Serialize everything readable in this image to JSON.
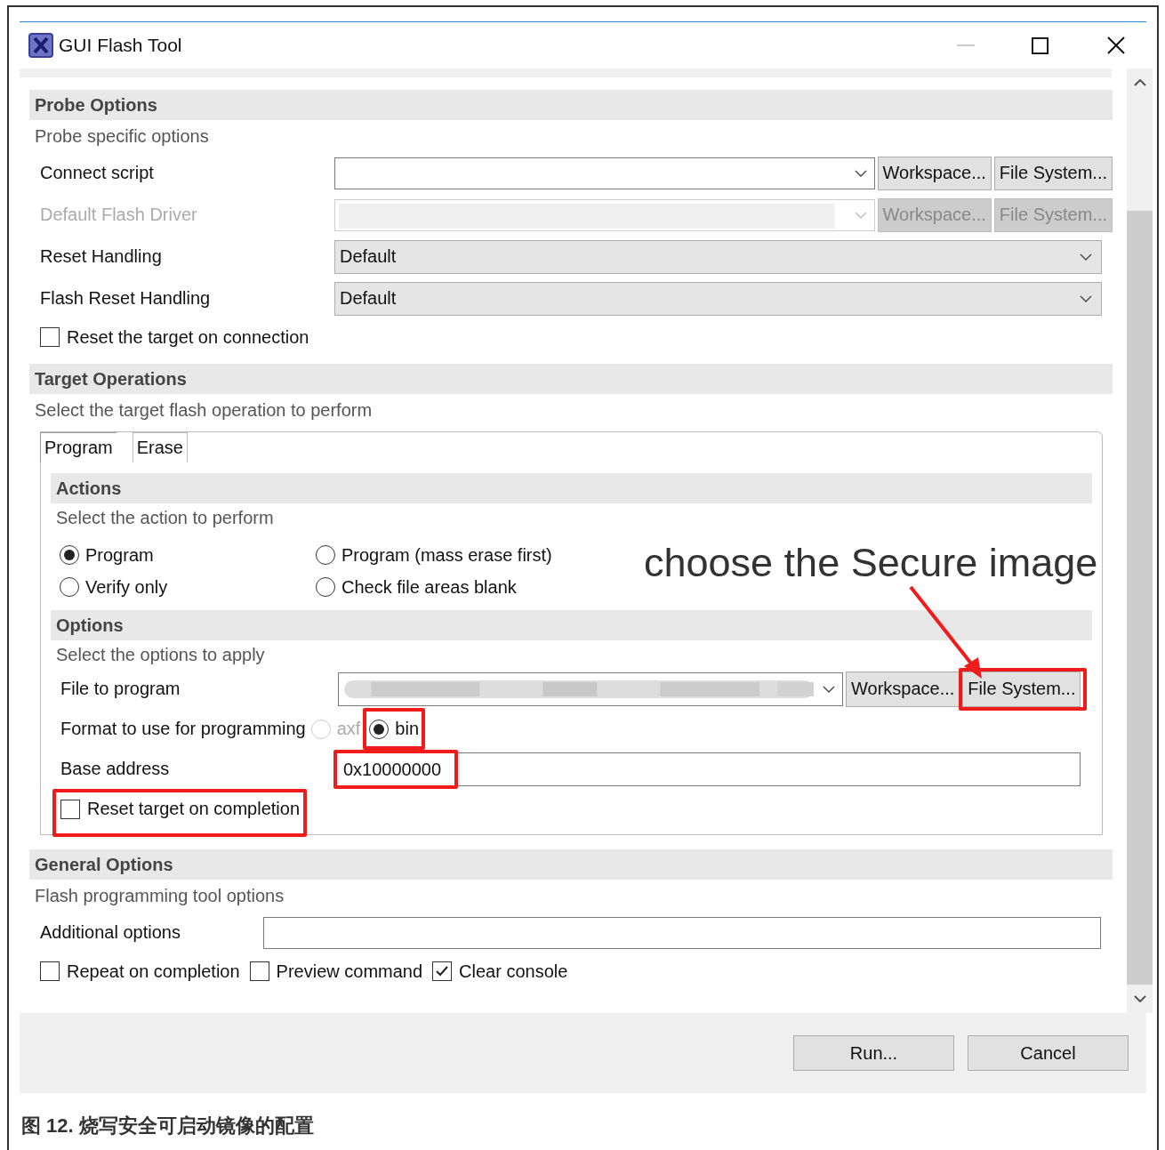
{
  "window": {
    "title": "GUI Flash Tool"
  },
  "probe_options": {
    "title": "Probe Options",
    "subtitle": "Probe specific options",
    "fields": [
      {
        "kind": "browse",
        "label": "Connect script",
        "disabled": false,
        "buttons": [
          "Workspace...",
          "File System..."
        ]
      },
      {
        "kind": "browse",
        "label": "Default Flash Driver",
        "disabled": true,
        "buttons": [
          "Workspace...",
          "File System..."
        ]
      },
      {
        "kind": "select",
        "label": "Reset Handling",
        "value": "Default"
      },
      {
        "kind": "select",
        "label": "Flash Reset Handling",
        "value": "Default"
      }
    ],
    "checkbox": {
      "label": "Reset the target on connection",
      "checked": false
    }
  },
  "target_operations": {
    "title": "Target Operations",
    "subtitle": "Select the target flash operation to perform",
    "tabs": [
      {
        "label": "Program",
        "selected": true
      },
      {
        "label": "Erase",
        "selected": false
      }
    ],
    "actions": {
      "title": "Actions",
      "subtitle": "Select the action to perform",
      "radios": [
        {
          "label": "Program",
          "selected": true
        },
        {
          "label": "Program (mass erase first)",
          "selected": false
        },
        {
          "label": "Verify only",
          "selected": false
        },
        {
          "label": "Check file areas blank",
          "selected": false
        }
      ]
    },
    "options": {
      "title": "Options",
      "subtitle": "Select the options to apply",
      "file_to_program": {
        "label": "File to program",
        "buttons": [
          {
            "label": "Workspace..."
          },
          {
            "label": "File System...",
            "highlighted": true
          }
        ]
      },
      "format": {
        "label": "Format to use for programming",
        "choices": [
          {
            "label": "axf",
            "selected": false,
            "disabled": true
          },
          {
            "label": "bin",
            "selected": true,
            "disabled": false,
            "highlighted": true
          }
        ]
      },
      "base_address": {
        "label": "Base address",
        "value": "0x10000000",
        "highlighted": true
      },
      "reset_checkbox": {
        "label": "Reset target on completion",
        "checked": false,
        "highlighted": true
      }
    }
  },
  "general_options": {
    "title": "General Options",
    "subtitle": "Flash programming tool options",
    "additional_options": {
      "label": "Additional options"
    },
    "checkboxes": [
      {
        "label": "Repeat on completion",
        "checked": false
      },
      {
        "label": "Preview command",
        "checked": false
      },
      {
        "label": "Clear console",
        "checked": true
      }
    ]
  },
  "buttons": [
    "Run...",
    "Cancel"
  ],
  "annotation": {
    "text": "choose the Secure image"
  },
  "caption": "图 12. 烧写安全可启动镜像的配置"
}
